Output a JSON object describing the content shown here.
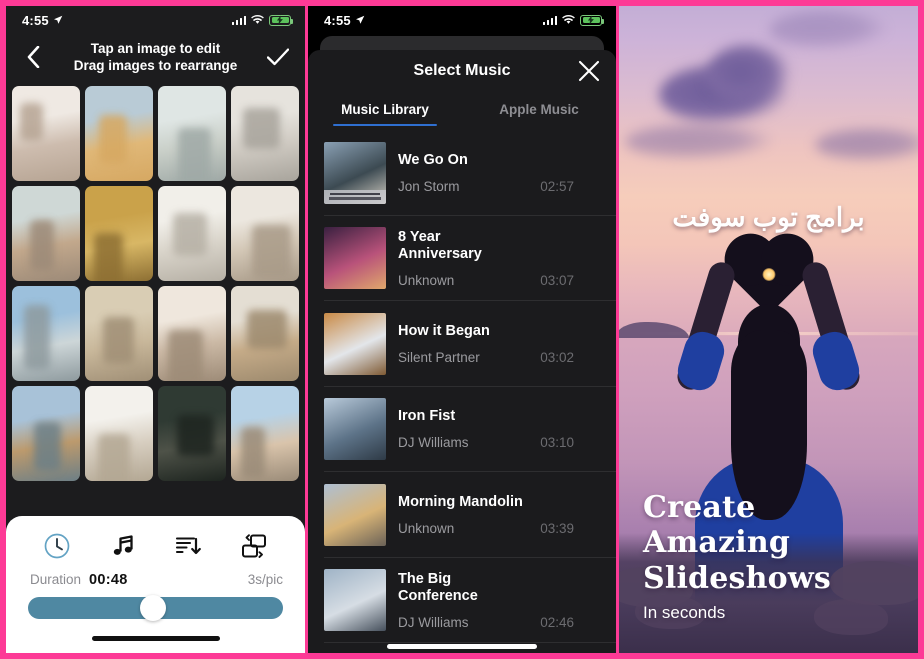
{
  "borders": {
    "accent_pink": "#fd3a96"
  },
  "left_panel": {
    "statusbar": {
      "time": "4:55",
      "location_icon": "location-arrow-icon",
      "signal_icon": "cellular-signal-icon",
      "wifi_icon": "wifi-icon",
      "battery_icon": "battery-charging-icon"
    },
    "header": {
      "back_icon": "chevron-left-icon",
      "title_line1": "Tap an image to edit",
      "title_line2": "Drag images to rearrange",
      "confirm_icon": "checkmark-icon"
    },
    "photo_grid": {
      "items": [
        {
          "alt": "beach figures",
          "c1": "#efe9e3",
          "c2": "#cdbcae",
          "c3": "#b6a493"
        },
        {
          "alt": "sand dunes",
          "c1": "#b9cbd6",
          "c2": "#e0b878",
          "c3": "#d6a862"
        },
        {
          "alt": "shoreline",
          "c1": "#dfe6e4",
          "c2": "#c9cfc8",
          "c3": "#9fa9a6"
        },
        {
          "alt": "sea walk",
          "c1": "#e6e3dd",
          "c2": "#cfcac2",
          "c3": "#a8a49c"
        },
        {
          "alt": "rocky coast",
          "c1": "#cfd8d6",
          "c2": "#c2a88c",
          "c3": "#9c8a78"
        },
        {
          "alt": "wheat field",
          "c1": "#caa24a",
          "c2": "#d8b765",
          "c3": "#8d6f33"
        },
        {
          "alt": "white sand",
          "c1": "#f1efe9",
          "c2": "#d9d4ca",
          "c3": "#b6b0a5"
        },
        {
          "alt": "beach stroll",
          "c1": "#ece7df",
          "c2": "#d3c7b6",
          "c3": "#a89a88"
        },
        {
          "alt": "blue sea",
          "c1": "#9cc0dc",
          "c2": "#cdd6d8",
          "c3": "#8e9a9e"
        },
        {
          "alt": "sand beach",
          "c1": "#d9cdb4",
          "c2": "#c8b79a",
          "c3": "#a08f76"
        },
        {
          "alt": "close portrait",
          "c1": "#efe7dd",
          "c2": "#cbb9a5",
          "c3": "#9d8b77"
        },
        {
          "alt": "cliff path",
          "c1": "#e4ded3",
          "c2": "#c5ab88",
          "c3": "#9d8a6e"
        },
        {
          "alt": "coastal cliff",
          "c1": "#a8c2d8",
          "c2": "#bc9a6d",
          "c3": "#6d7f86"
        },
        {
          "alt": "rock arch",
          "c1": "#f3f1ec",
          "c2": "#d7cec0",
          "c3": "#b3a793"
        },
        {
          "alt": "night shot",
          "c1": "#2f3a33",
          "c2": "#4e5248",
          "c3": "#1d241f"
        },
        {
          "alt": "village view",
          "c1": "#b7d2e6",
          "c2": "#d9c4ab",
          "c3": "#9a8b78"
        }
      ]
    },
    "toolbar": {
      "buttons": [
        {
          "label": "Duration",
          "icon": "clock-icon",
          "active": true
        },
        {
          "label": "Music",
          "icon": "music-note-icon",
          "active": false
        },
        {
          "label": "Order",
          "icon": "sort-descending-icon",
          "active": false
        },
        {
          "label": "Transition",
          "icon": "transition-icon",
          "active": false
        }
      ],
      "duration_label": "Duration",
      "duration_value": "00:48",
      "rate_value": "3s/pic",
      "slider_percent": 49,
      "slider_color": "#4f88a2"
    }
  },
  "middle_panel": {
    "statusbar": {
      "time": "4:55",
      "location_icon": "location-arrow-icon",
      "signal_icon": "cellular-signal-icon",
      "wifi_icon": "wifi-icon",
      "battery_icon": "battery-charging-icon"
    },
    "sheet": {
      "title": "Select Music",
      "close_icon": "close-x-icon",
      "tabs": [
        {
          "label": "Music Library",
          "active": true
        },
        {
          "label": "Apple Music",
          "active": false
        }
      ],
      "accent": "#2f6fd0"
    },
    "tracks": [
      {
        "title": "We Go On",
        "artist": "Jon Storm",
        "duration": "02:57",
        "art": "man-city-portrait",
        "a1": "#8aa0b4",
        "a2": "#3c4a52",
        "a3": "#d8d2c6"
      },
      {
        "title": "8 Year Anniversary",
        "artist": "Unknown",
        "duration": "03:07",
        "art": "concert-crowd",
        "a1": "#3a2040",
        "a2": "#b8527a",
        "a3": "#e0a86c"
      },
      {
        "title": "How it Began",
        "artist": "Silent Partner",
        "duration": "03:02",
        "art": "canal-buildings",
        "a1": "#c98a46",
        "a2": "#e3e6ea",
        "a3": "#7f5a33"
      },
      {
        "title": "Iron Fist",
        "artist": "DJ Williams",
        "duration": "03:10",
        "art": "chain-link-fence",
        "a1": "#b9cada",
        "a2": "#5d7388",
        "a3": "#2e3a46"
      },
      {
        "title": "Morning Mandolin",
        "artist": "Unknown",
        "duration": "03:39",
        "art": "desert-road",
        "a1": "#aebfd2",
        "a2": "#d8b477",
        "a3": "#6b6257"
      },
      {
        "title": "The Big Conference",
        "artist": "DJ Williams",
        "duration": "02:46",
        "art": "highway-clouds",
        "a1": "#9fb3c6",
        "a2": "#d6dde4",
        "a3": "#46505c"
      }
    ]
  },
  "right_panel": {
    "watermark_arabic": "برامج توب سوفت",
    "headline_lines": [
      "Create",
      "Amazing",
      "Slideshows"
    ],
    "subline": "In seconds",
    "scene": {
      "description": "woman-heart-hands-sunset-silhouette",
      "sky_top": "#c3aed6",
      "sky_bottom": "#f6cdbb",
      "sea": "#c295b8",
      "dress": "#1f3fa0"
    }
  }
}
